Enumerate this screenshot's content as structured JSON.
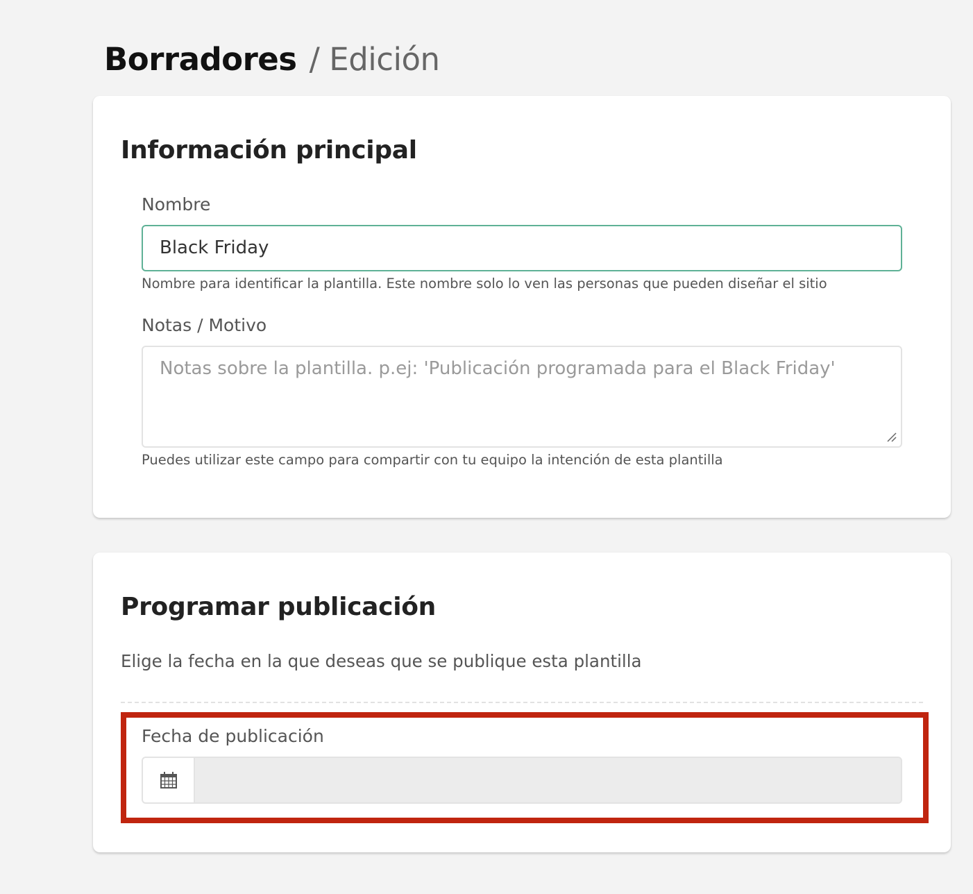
{
  "breadcrumb": {
    "root": "Borradores",
    "separator": "/",
    "current": "Edición"
  },
  "main_info": {
    "title": "Información principal",
    "name": {
      "label": "Nombre",
      "value": "Black Friday",
      "help": "Nombre para identificar la plantilla. Este nombre solo lo ven las personas que pueden diseñar el sitio"
    },
    "notes": {
      "label": "Notas / Motivo",
      "value": "",
      "placeholder": "Notas sobre la plantilla. p.ej: 'Publicación programada para el Black Friday'",
      "help": "Puedes utilizar este campo para compartir con tu equipo la intención de esta plantilla"
    }
  },
  "schedule": {
    "title": "Programar publicación",
    "description": "Elige la fecha en la que deseas que se publique esta plantilla",
    "date": {
      "label": "Fecha de publicación",
      "value": "",
      "icon": "calendar-icon"
    }
  },
  "colors": {
    "active_border": "#5fb196",
    "highlight": "#c0250f",
    "background": "#f3f3f3"
  }
}
